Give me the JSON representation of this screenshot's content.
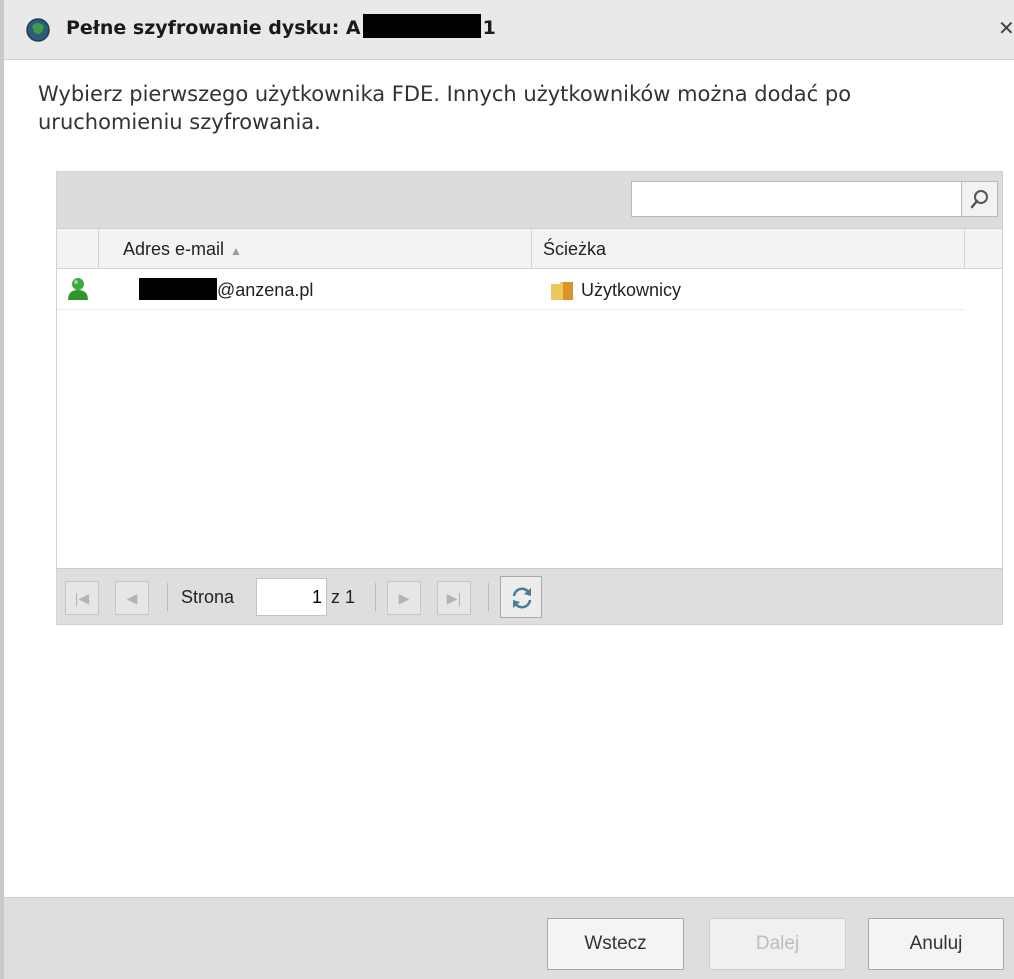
{
  "window": {
    "title_prefix": "Pełne szyfrowanie dysku: A",
    "title_suffix": "1",
    "close_glyph": "✕"
  },
  "instruction": "Wybierz pierwszego użytkownika FDE. Innych użytkowników można dodać po uruchomieniu szyfrowania.",
  "grid": {
    "search": {
      "value": "",
      "placeholder": ""
    },
    "columns": {
      "email": "Adres e-mail",
      "path": "Ścieżka"
    },
    "sort_indicator": "▲",
    "rows": [
      {
        "email_suffix": "@anzena.pl",
        "path": "Użytkownicy",
        "icon": "user-icon"
      }
    ]
  },
  "paging": {
    "page_label": "Strona",
    "current_page": "1",
    "of_label": "z 1"
  },
  "footer": {
    "back": "Wstecz",
    "next": "Dalej",
    "cancel": "Anuluj"
  },
  "colors": {
    "user_icon": "#3daa3d",
    "folder_icon": "#e8b23a"
  }
}
